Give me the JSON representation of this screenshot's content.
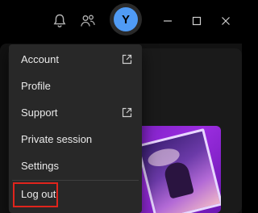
{
  "titlebar": {
    "notifications_icon": "bell-icon",
    "friends_icon": "friends-activity-icon",
    "avatar_initial": "Y",
    "avatar_color": "#509bf5",
    "minimize_icon": "minimize-icon",
    "maximize_icon": "maximize-icon",
    "close_icon": "close-icon"
  },
  "menu": {
    "items": [
      {
        "label": "Account",
        "icon": "external-link-icon"
      },
      {
        "label": "Profile"
      },
      {
        "label": "Support",
        "icon": "external-link-icon"
      },
      {
        "label": "Private session"
      },
      {
        "label": "Settings"
      }
    ],
    "logout_label": "Log out",
    "highlight_color": "#e0241c"
  },
  "album_card": {
    "accent_color": "#9b2de0"
  }
}
